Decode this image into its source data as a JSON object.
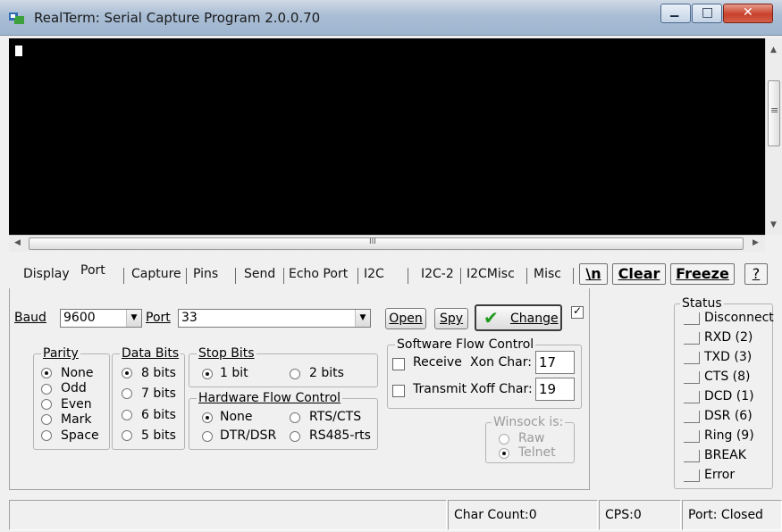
{
  "window": {
    "title": "RealTerm: Serial Capture Program 2.0.0.70",
    "minimize_glyph": "▁",
    "maximize_glyph": "□",
    "close_glyph": "✕"
  },
  "scroll": {
    "h_center_glyph": "III",
    "v_grip_glyph": "≡"
  },
  "tabs": [
    "Display",
    "Port",
    "Capture",
    "Pins",
    "Send",
    "Echo Port",
    "I2C",
    "I2C-2",
    "I2CMisc",
    "Misc"
  ],
  "active_tab": "Port",
  "quick_buttons": {
    "newline": "\\n",
    "clear": "Clear",
    "freeze": "Freeze",
    "help": "?"
  },
  "port": {
    "baud_label": "Baud",
    "baud_value": "9600",
    "port_label": "Port",
    "port_value": "33",
    "open_button": "Open",
    "spy_button": "Spy",
    "change_button": "Change",
    "change_checked": true
  },
  "parity": {
    "title": "Parity",
    "options": [
      "None",
      "Odd",
      "Even",
      "Mark",
      "Space"
    ],
    "selected": "None"
  },
  "data_bits": {
    "title": "Data Bits",
    "options": [
      "8 bits",
      "7 bits",
      "6 bits",
      "5 bits"
    ],
    "selected": "8 bits"
  },
  "stop_bits": {
    "title": "Stop Bits",
    "options": [
      "1 bit",
      "2 bits"
    ],
    "selected": "1 bit"
  },
  "hw_flow": {
    "title": "Hardware Flow Control",
    "options": [
      "None",
      "RTS/CTS",
      "DTR/DSR",
      "RS485-rts"
    ],
    "selected": "None"
  },
  "sw_flow": {
    "title": "Software Flow Control",
    "receive_label": "Receive",
    "transmit_label": "Transmit",
    "xon_label": "Xon Char:",
    "xon_value": "17",
    "xoff_label": "Xoff Char:",
    "xoff_value": "19"
  },
  "winsock": {
    "title": "Winsock is:",
    "options": [
      "Raw",
      "Telnet"
    ],
    "selected": "Telnet"
  },
  "status": {
    "title": "Status",
    "items": [
      "Disconnect",
      "RXD (2)",
      "TXD (3)",
      "CTS (8)",
      "DCD (1)",
      "DSR (6)",
      "Ring (9)",
      "BREAK",
      "Error"
    ]
  },
  "statusbar": {
    "char_count": "Char Count:0",
    "cps": "CPS:0",
    "port_state": "Port: Closed"
  },
  "colors": {
    "terminal_bg": "#000000",
    "check_green": "#1f9a1f"
  }
}
